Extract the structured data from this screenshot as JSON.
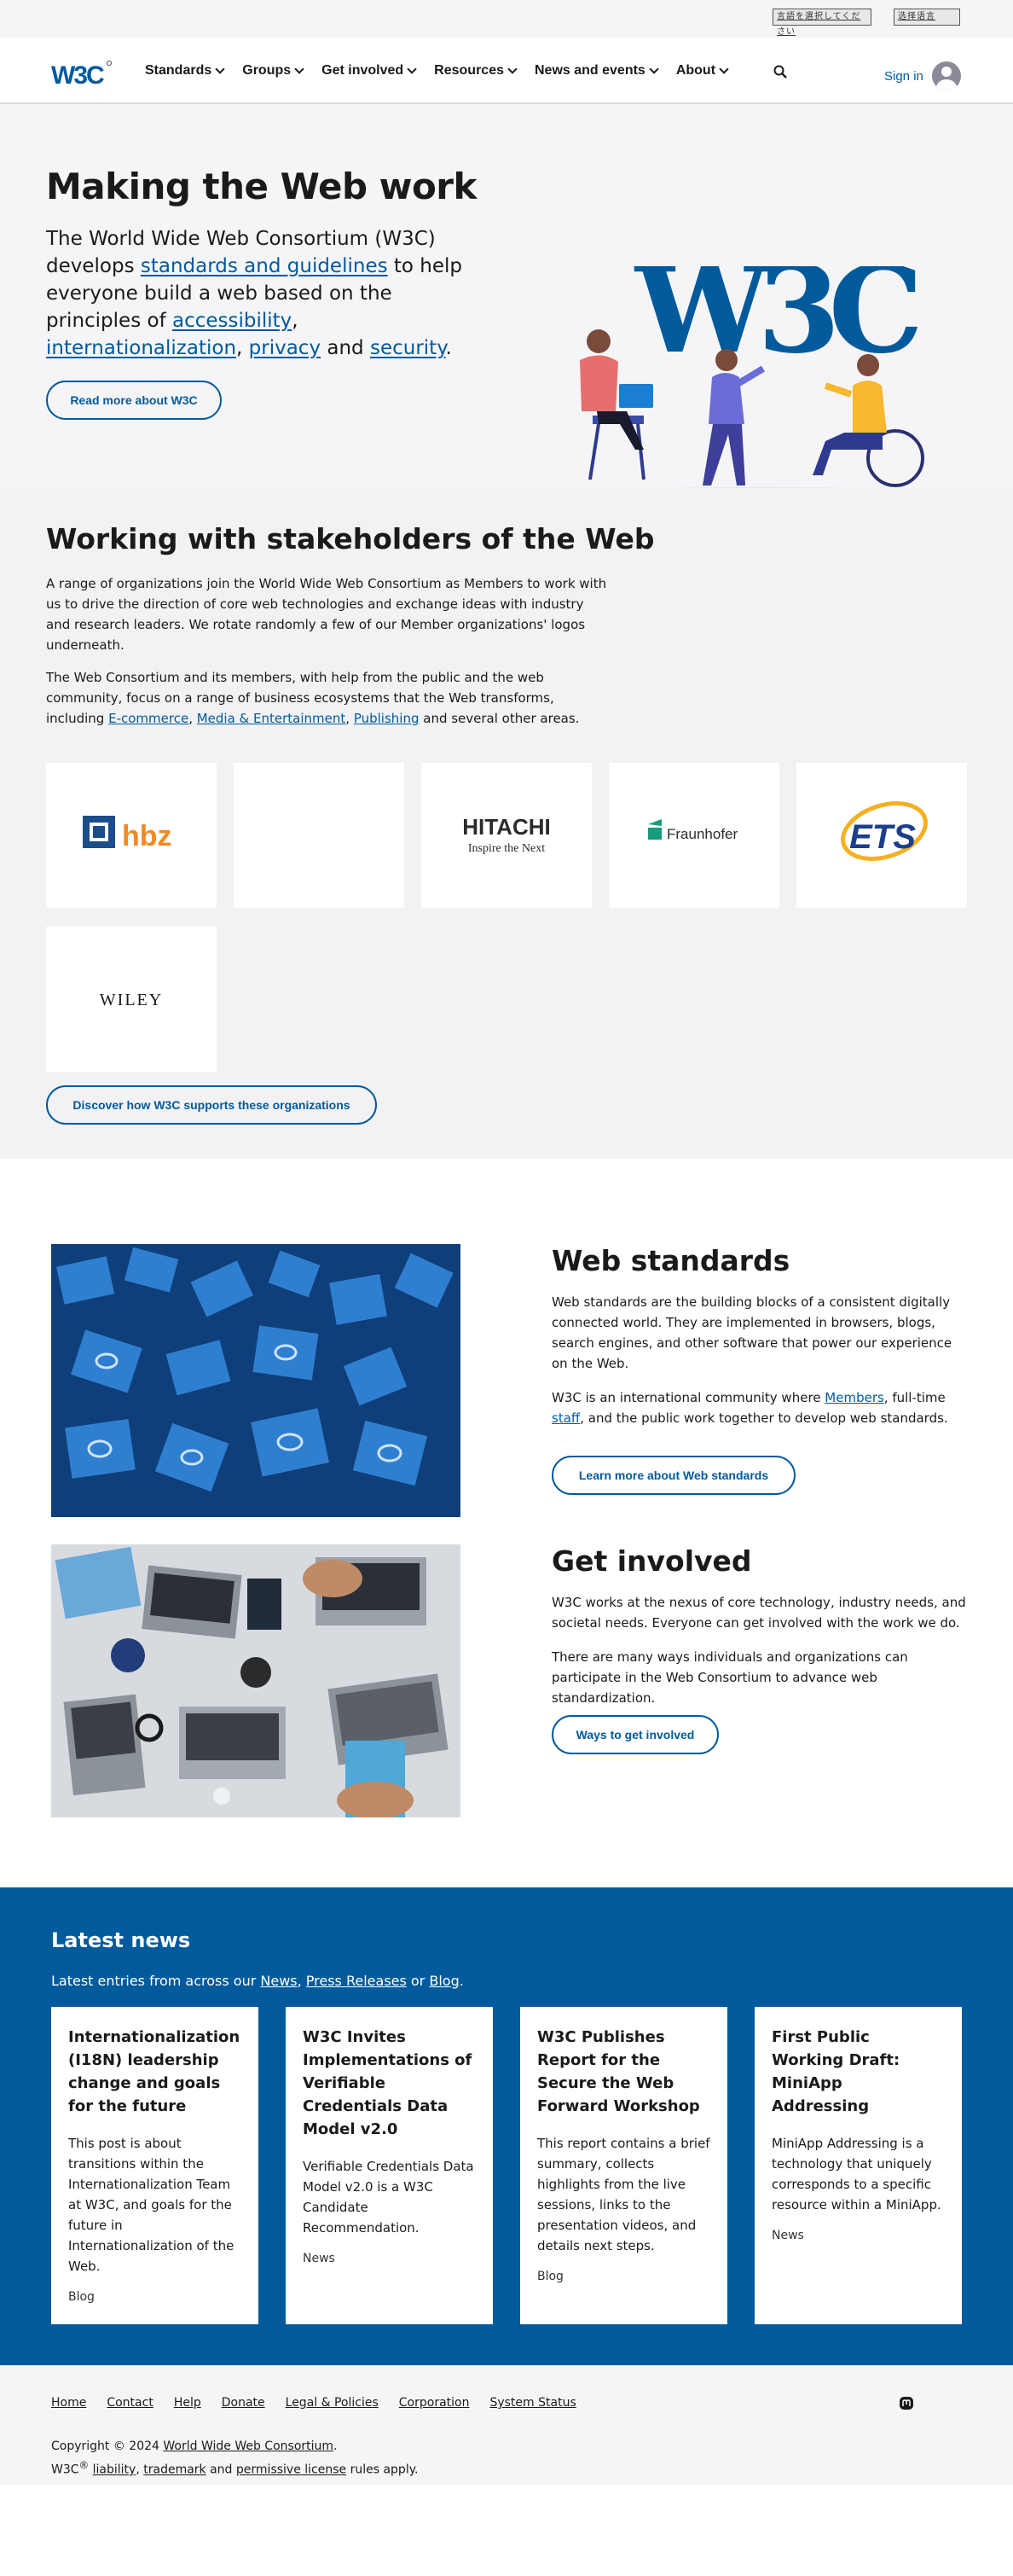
{
  "language_switcher": [
    "言語を選択してください",
    "选择语言"
  ],
  "nav": {
    "logo_text": "W3C",
    "items": [
      "Standards",
      "Groups",
      "Get involved",
      "Resources",
      "News and events",
      "About"
    ],
    "search_icon": "search-icon",
    "sign_in": "Sign in"
  },
  "hero": {
    "title": "Making the Web work",
    "lead_1": "The World Wide Web Consortium (W3C) develops ",
    "link_standards": "standards and guidelines",
    "lead_2": " to help everyone build a web based on the principles of ",
    "link_accessibility": "accessibility",
    "comma1": ", ",
    "link_i18n": "internationalization",
    "comma2": ", ",
    "link_privacy": "privacy",
    "and": " and ",
    "link_security": "security",
    "period": ".",
    "button": "Read more about W3C",
    "illustration_text": "W3C"
  },
  "stakeholders": {
    "title": "Working with stakeholders of the Web",
    "p1": "A range of organizations join the World Wide Web Consortium as Members to work with us to drive the direction of core web technologies and exchange ideas with industry and research leaders. We rotate randomly a few of our Member organizations' logos underneath.",
    "p2_start": "The Web Consortium and its members, with help from the public and the web community, focus on a range of business ecosystems that the Web transforms, including ",
    "link_ecommerce": "E-commerce",
    "link_media": "Media & Entertainment",
    "link_publishing": "Publishing",
    "p2_end": " and several other areas.",
    "logos": [
      "hbz",
      "",
      "HITACHI",
      "Fraunhofer",
      "ETS",
      "WILEY"
    ],
    "hitachi_tagline": "Inspire the Next",
    "button": "Discover how W3C supports these organizations"
  },
  "web_standards": {
    "title": "Web standards",
    "p1": "Web standards are the building blocks of a consistent digitally connected world. They are implemented in browsers, blogs, search engines, and other software that power our experience on the Web.",
    "p2_start": "W3C is an international community where ",
    "link_members": "Members",
    "p2_mid": ", full-time ",
    "link_staff": "staff",
    "p2_end": ", and the public work together to develop web standards.",
    "button": "Learn more about Web standards"
  },
  "get_involved": {
    "title": "Get involved",
    "p1": "W3C works at the nexus of core technology, industry needs, and societal needs. Everyone can get involved with the work we do.",
    "p2": "There are many ways individuals and organizations can participate in the Web Consortium to advance web standardization.",
    "button": "Ways to get involved"
  },
  "news": {
    "title": "Latest news",
    "intro_start": "Latest entries from across our ",
    "link_news": "News",
    "sep1": ", ",
    "link_press": "Press Releases",
    "sep2": " or ",
    "link_blog": "Blog",
    "intro_end": ".",
    "cards": [
      {
        "title": "Internationalization (I18N) leadership change and goals for the future",
        "body": "This post is about transitions within the Internationalization Team at W3C, and goals for the future in Internationalization of the Web.",
        "tag": "Blog"
      },
      {
        "title": "W3C Invites Implementations of Verifiable Credentials Data Model v2.0",
        "body": "Verifiable Credentials Data Model v2.0 is a W3C Candidate Recommendation.",
        "tag": "News"
      },
      {
        "title": "W3C Publishes Report for the Secure the Web Forward Workshop",
        "body": "This report contains a brief summary, collects highlights from the live sessions, links to the presentation videos, and details next steps.",
        "tag": "Blog"
      },
      {
        "title": "First Public Working Draft: MiniApp Addressing",
        "body": "MiniApp Addressing is a technology that uniquely corresponds to a specific resource within a MiniApp.",
        "tag": "News"
      }
    ]
  },
  "footer": {
    "links": [
      "Home",
      "Contact",
      "Help",
      "Donate",
      "Legal & Policies",
      "Corporation",
      "System Status"
    ],
    "social_icon": "mastodon-icon",
    "copy_start": "Copyright © 2024 ",
    "link_wwwc": "World Wide Web Consortium",
    "copy_period": ".",
    "w3c": "W3C",
    "reg": "®",
    "link_liability": "liability",
    "sep": ", ",
    "link_trademark": "trademark",
    "and": " and ",
    "link_license": "permissive license",
    "copy_end": " rules apply."
  },
  "colors": {
    "brand_blue": "#005a9c",
    "page_gray": "#f5f5f7"
  }
}
